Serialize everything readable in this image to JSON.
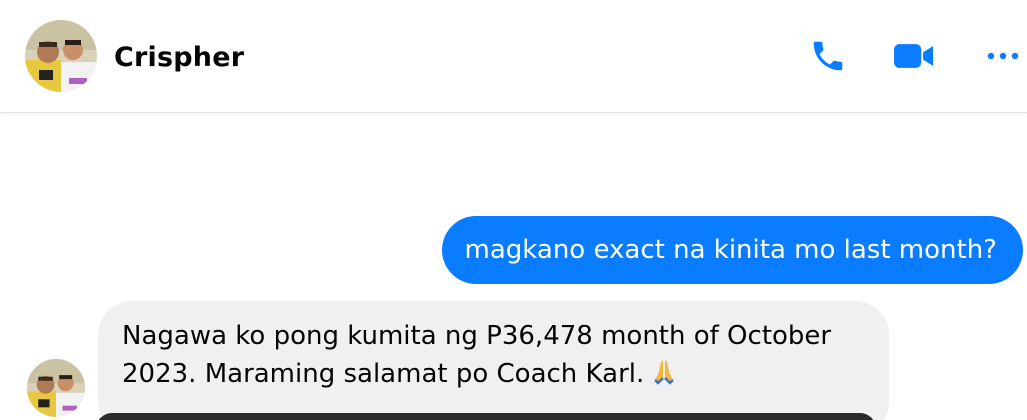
{
  "conversation": {
    "contact_name": "Crispher"
  },
  "header": {
    "icons": [
      "phone-icon",
      "video-camera-icon",
      "more-options-icon"
    ]
  },
  "messages": [
    {
      "direction": "outgoing",
      "text": "magkano exact na kinita mo last month?"
    },
    {
      "direction": "incoming",
      "text": "Nagawa ko pong kumita ng P36,478 month of October 2023. Maraming salamat po Coach Karl.",
      "emoji": "🙏"
    }
  ],
  "colors": {
    "accent": "#0a7cff",
    "incoming_bubble": "#f0f0f0",
    "text": "#050505"
  }
}
